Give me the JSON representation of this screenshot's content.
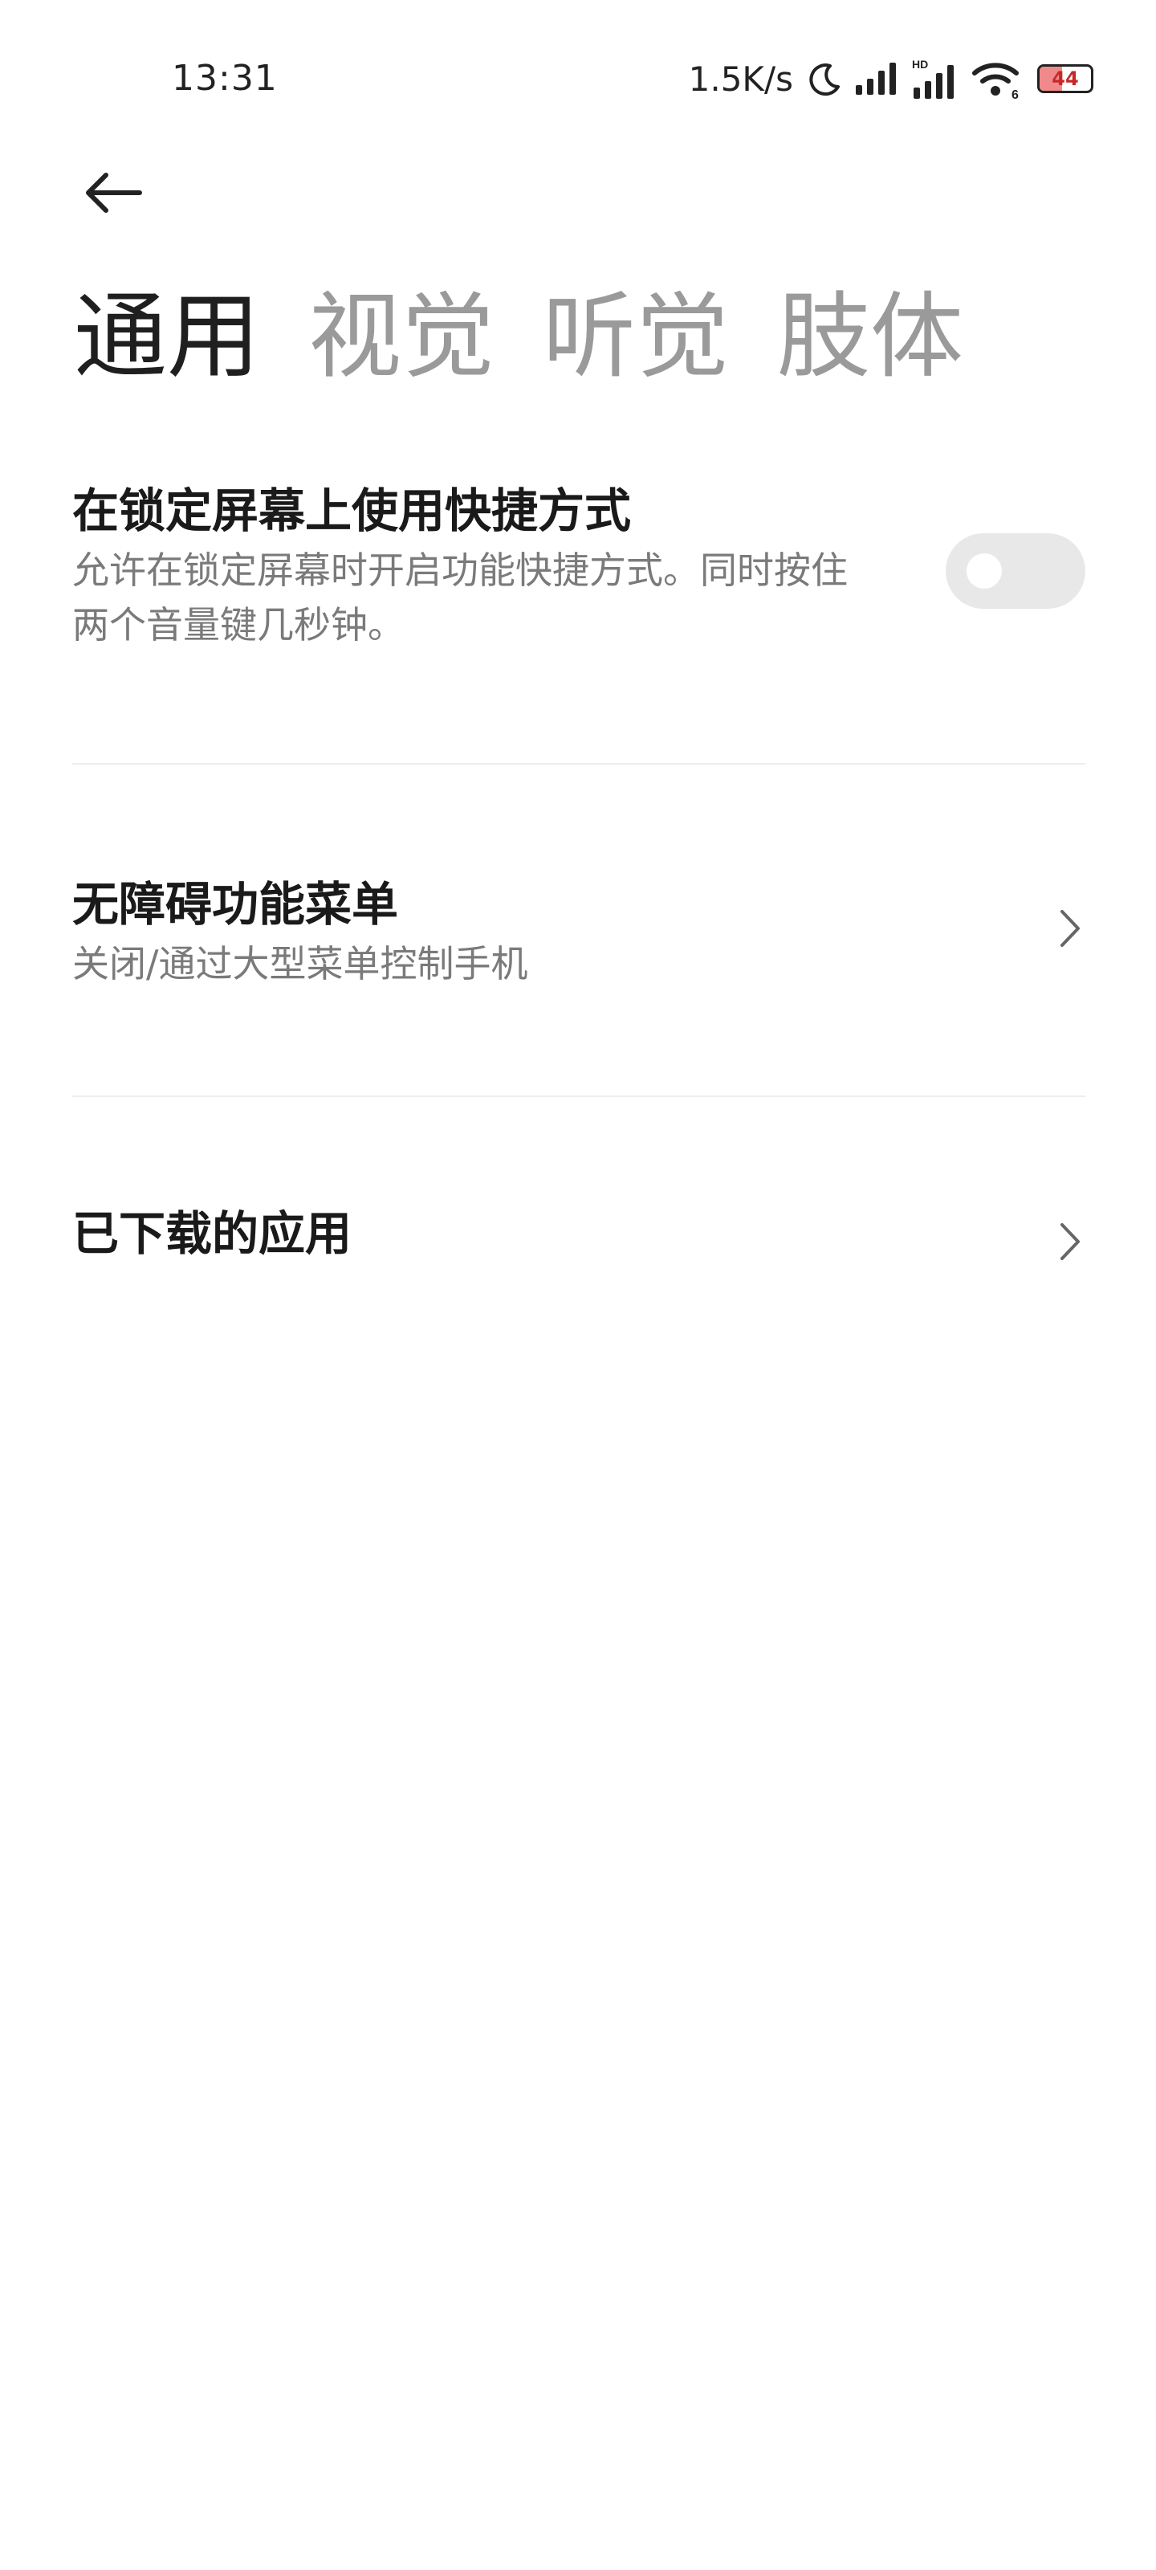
{
  "status_bar": {
    "time": "13:31",
    "net_speed": "1.5K/s",
    "hd_label": "HD",
    "wifi_label": "6",
    "battery_level": "44",
    "battery_fraction": 0.44
  },
  "tabs": [
    {
      "label": "通用",
      "active": true
    },
    {
      "label": "视觉",
      "active": false
    },
    {
      "label": "听觉",
      "active": false
    },
    {
      "label": "肢体",
      "active": false
    }
  ],
  "settings": {
    "lock_shortcut": {
      "title": "在锁定屏幕上使用快捷方式",
      "description_line1": "允许在锁定屏幕时开启功能快捷方式。同时按住",
      "description_line2": "两个音量键几秒钟。",
      "enabled": false
    },
    "accessibility_menu": {
      "title": "无障碍功能菜单",
      "description": "关闭/通过大型菜单控制手机"
    },
    "downloaded_apps": {
      "title": "已下载的应用"
    }
  }
}
